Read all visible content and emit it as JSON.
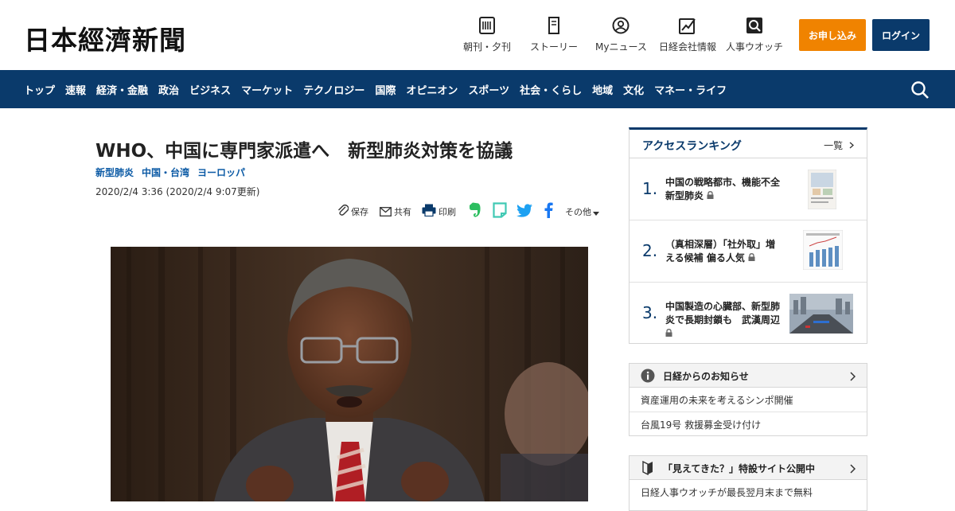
{
  "header": {
    "logo": "日本經濟新聞",
    "nav_icons": [
      {
        "label": "朝刊・夕刊",
        "icon": "newspaper-icon"
      },
      {
        "label": "ストーリー",
        "icon": "book-icon"
      },
      {
        "label": "Myニュース",
        "icon": "user-icon"
      },
      {
        "label": "日経会社情報",
        "icon": "chart-icon"
      },
      {
        "label": "人事ウオッチ",
        "icon": "search-person-icon"
      }
    ],
    "apply_label": "お申し込み",
    "login_label": "ログイン",
    "colors": {
      "navy": "#0a3a6b",
      "orange": "#f08300",
      "link": "#0b5aa5"
    }
  },
  "nav": {
    "items": [
      "トップ",
      "速報",
      "経済・金融",
      "政治",
      "ビジネス",
      "マーケット",
      "テクノロジー",
      "国際",
      "オピニオン",
      "スポーツ",
      "社会・くらし",
      "地域",
      "文化",
      "マネー・ライフ"
    ],
    "search_icon": "search-icon"
  },
  "article": {
    "title": "WHO、中国に専門家派遣へ　新型肺炎対策を協議",
    "tags": [
      "新型肺炎",
      "中国・台湾",
      "ヨーロッパ"
    ],
    "date": "2020/2/4 3:36 (2020/2/4 9:07更新)",
    "share": {
      "save": "保存",
      "share": "共有",
      "print": "印刷",
      "more": "その他"
    }
  },
  "ranking": {
    "title": "アクセスランキング",
    "all_label": "一覧",
    "items": [
      {
        "rank": "1.",
        "text": "中国の戦略都市、機能不全　新型肺炎"
      },
      {
        "rank": "2.",
        "text": "（真相深層）「社外取」増える候補 偏る人気"
      },
      {
        "rank": "3.",
        "text": "中国製造の心臓部、新型肺炎で長期封鎖も　武漢周辺"
      }
    ]
  },
  "notices": {
    "title": "日経からのお知らせ",
    "items": [
      "資産運用の未来を考えるシンポ開催",
      "台風19号 救援募金受け付け"
    ]
  },
  "promo": {
    "title": "「見えてきた？」特設サイト公開中",
    "items": [
      "日経人事ウオッチが最長翌月末まで無料"
    ]
  }
}
